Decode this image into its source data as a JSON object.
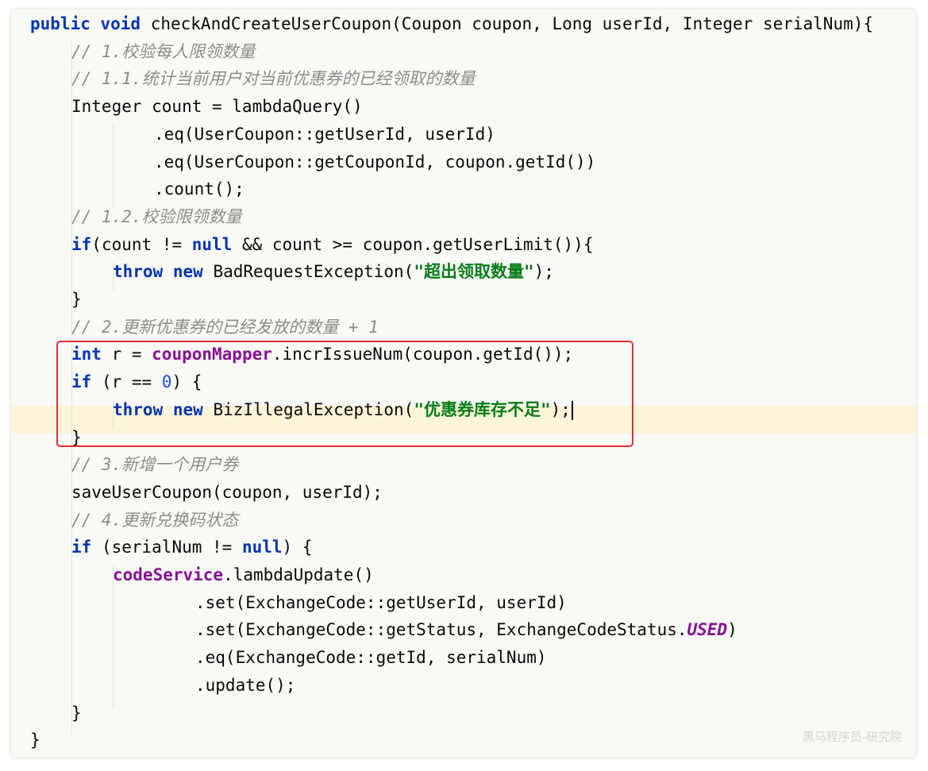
{
  "code_lines": [
    {
      "indent": 0,
      "parts": [
        {
          "k": "kw",
          "t": "public void "
        },
        {
          "k": "",
          "t": "checkAndCreateUserCoupon(Coupon coupon, Long userId, Integer serialNum){"
        }
      ]
    },
    {
      "indent": 1,
      "parts": [
        {
          "k": "cm",
          "t": "// 1.校验每人限领数量"
        }
      ]
    },
    {
      "indent": 1,
      "parts": [
        {
          "k": "cm",
          "t": "// 1.1.统计当前用户对当前优惠券的已经领取的数量"
        }
      ]
    },
    {
      "indent": 1,
      "parts": [
        {
          "k": "",
          "t": "Integer count = lambdaQuery()"
        }
      ]
    },
    {
      "indent": 3,
      "parts": [
        {
          "k": "",
          "t": ".eq(UserCoupon::getUserId, userId)"
        }
      ]
    },
    {
      "indent": 3,
      "parts": [
        {
          "k": "",
          "t": ".eq(UserCoupon::getCouponId, coupon.getId())"
        }
      ]
    },
    {
      "indent": 3,
      "parts": [
        {
          "k": "",
          "t": ".count();"
        }
      ]
    },
    {
      "indent": 1,
      "parts": [
        {
          "k": "cm",
          "t": "// 1.2.校验限领数量"
        }
      ]
    },
    {
      "indent": 1,
      "parts": [
        {
          "k": "kw",
          "t": "if"
        },
        {
          "k": "",
          "t": "(count != "
        },
        {
          "k": "kw",
          "t": "null"
        },
        {
          "k": "",
          "t": " && count >= coupon.getUserLimit()){"
        }
      ]
    },
    {
      "indent": 2,
      "parts": [
        {
          "k": "kw",
          "t": "throw new "
        },
        {
          "k": "",
          "t": "BadRequestException("
        },
        {
          "k": "str",
          "t": "\"超出领取数量\""
        },
        {
          "k": "",
          "t": ");"
        }
      ]
    },
    {
      "indent": 1,
      "parts": [
        {
          "k": "",
          "t": "}"
        }
      ]
    },
    {
      "indent": 1,
      "parts": [
        {
          "k": "cm",
          "t": "// 2.更新优惠券的已经发放的数量 + 1"
        }
      ]
    },
    {
      "indent": 1,
      "parts": [
        {
          "k": "kw",
          "t": "int "
        },
        {
          "k": "",
          "t": "r = "
        },
        {
          "k": "fld",
          "t": "couponMapper"
        },
        {
          "k": "",
          "t": ".incrIssueNum(coupon.getId());"
        }
      ]
    },
    {
      "indent": 1,
      "parts": [
        {
          "k": "kw",
          "t": "if "
        },
        {
          "k": "",
          "t": "(r == "
        },
        {
          "k": "num",
          "t": "0"
        },
        {
          "k": "",
          "t": ") {"
        }
      ]
    },
    {
      "indent": 2,
      "caret": true,
      "parts": [
        {
          "k": "kw",
          "t": "throw new "
        },
        {
          "k": "",
          "t": "BizIllegalException("
        },
        {
          "k": "str",
          "t": "\"优惠券库存不足\""
        },
        {
          "k": "",
          "t": ");"
        }
      ]
    },
    {
      "indent": 1,
      "parts": [
        {
          "k": "",
          "t": "}"
        }
      ]
    },
    {
      "indent": 1,
      "parts": [
        {
          "k": "cm",
          "t": "// 3.新增一个用户券"
        }
      ]
    },
    {
      "indent": 1,
      "parts": [
        {
          "k": "",
          "t": "saveUserCoupon(coupon, userId);"
        }
      ]
    },
    {
      "indent": 1,
      "parts": [
        {
          "k": "cm",
          "t": "// 4.更新兑换码状态"
        }
      ]
    },
    {
      "indent": 1,
      "parts": [
        {
          "k": "kw",
          "t": "if "
        },
        {
          "k": "",
          "t": "(serialNum != "
        },
        {
          "k": "kw",
          "t": "null"
        },
        {
          "k": "",
          "t": ") {"
        }
      ]
    },
    {
      "indent": 2,
      "parts": [
        {
          "k": "fld",
          "t": "codeService"
        },
        {
          "k": "",
          "t": ".lambdaUpdate()"
        }
      ]
    },
    {
      "indent": 4,
      "parts": [
        {
          "k": "",
          "t": ".set(ExchangeCode::getUserId, userId)"
        }
      ]
    },
    {
      "indent": 4,
      "parts": [
        {
          "k": "",
          "t": ".set(ExchangeCode::getStatus, ExchangeCodeStatus."
        },
        {
          "k": "fld-i",
          "t": "USED"
        },
        {
          "k": "",
          "t": ")"
        }
      ]
    },
    {
      "indent": 4,
      "parts": [
        {
          "k": "",
          "t": ".eq(ExchangeCode::getId, serialNum)"
        }
      ]
    },
    {
      "indent": 4,
      "parts": [
        {
          "k": "",
          "t": ".update();"
        }
      ]
    },
    {
      "indent": 1,
      "parts": [
        {
          "k": "",
          "t": "}"
        }
      ]
    },
    {
      "indent": 0,
      "parts": [
        {
          "k": "",
          "t": "}"
        }
      ]
    }
  ],
  "watermark": "黑马程序员-研究院",
  "colors": {
    "keyword": "#0033b3",
    "comment": "#8c8c8c",
    "field": "#871094",
    "string": "#067d17",
    "number": "#1750eb",
    "highlight_box": "#e0312f",
    "caret_line": "#fcf5d9"
  }
}
